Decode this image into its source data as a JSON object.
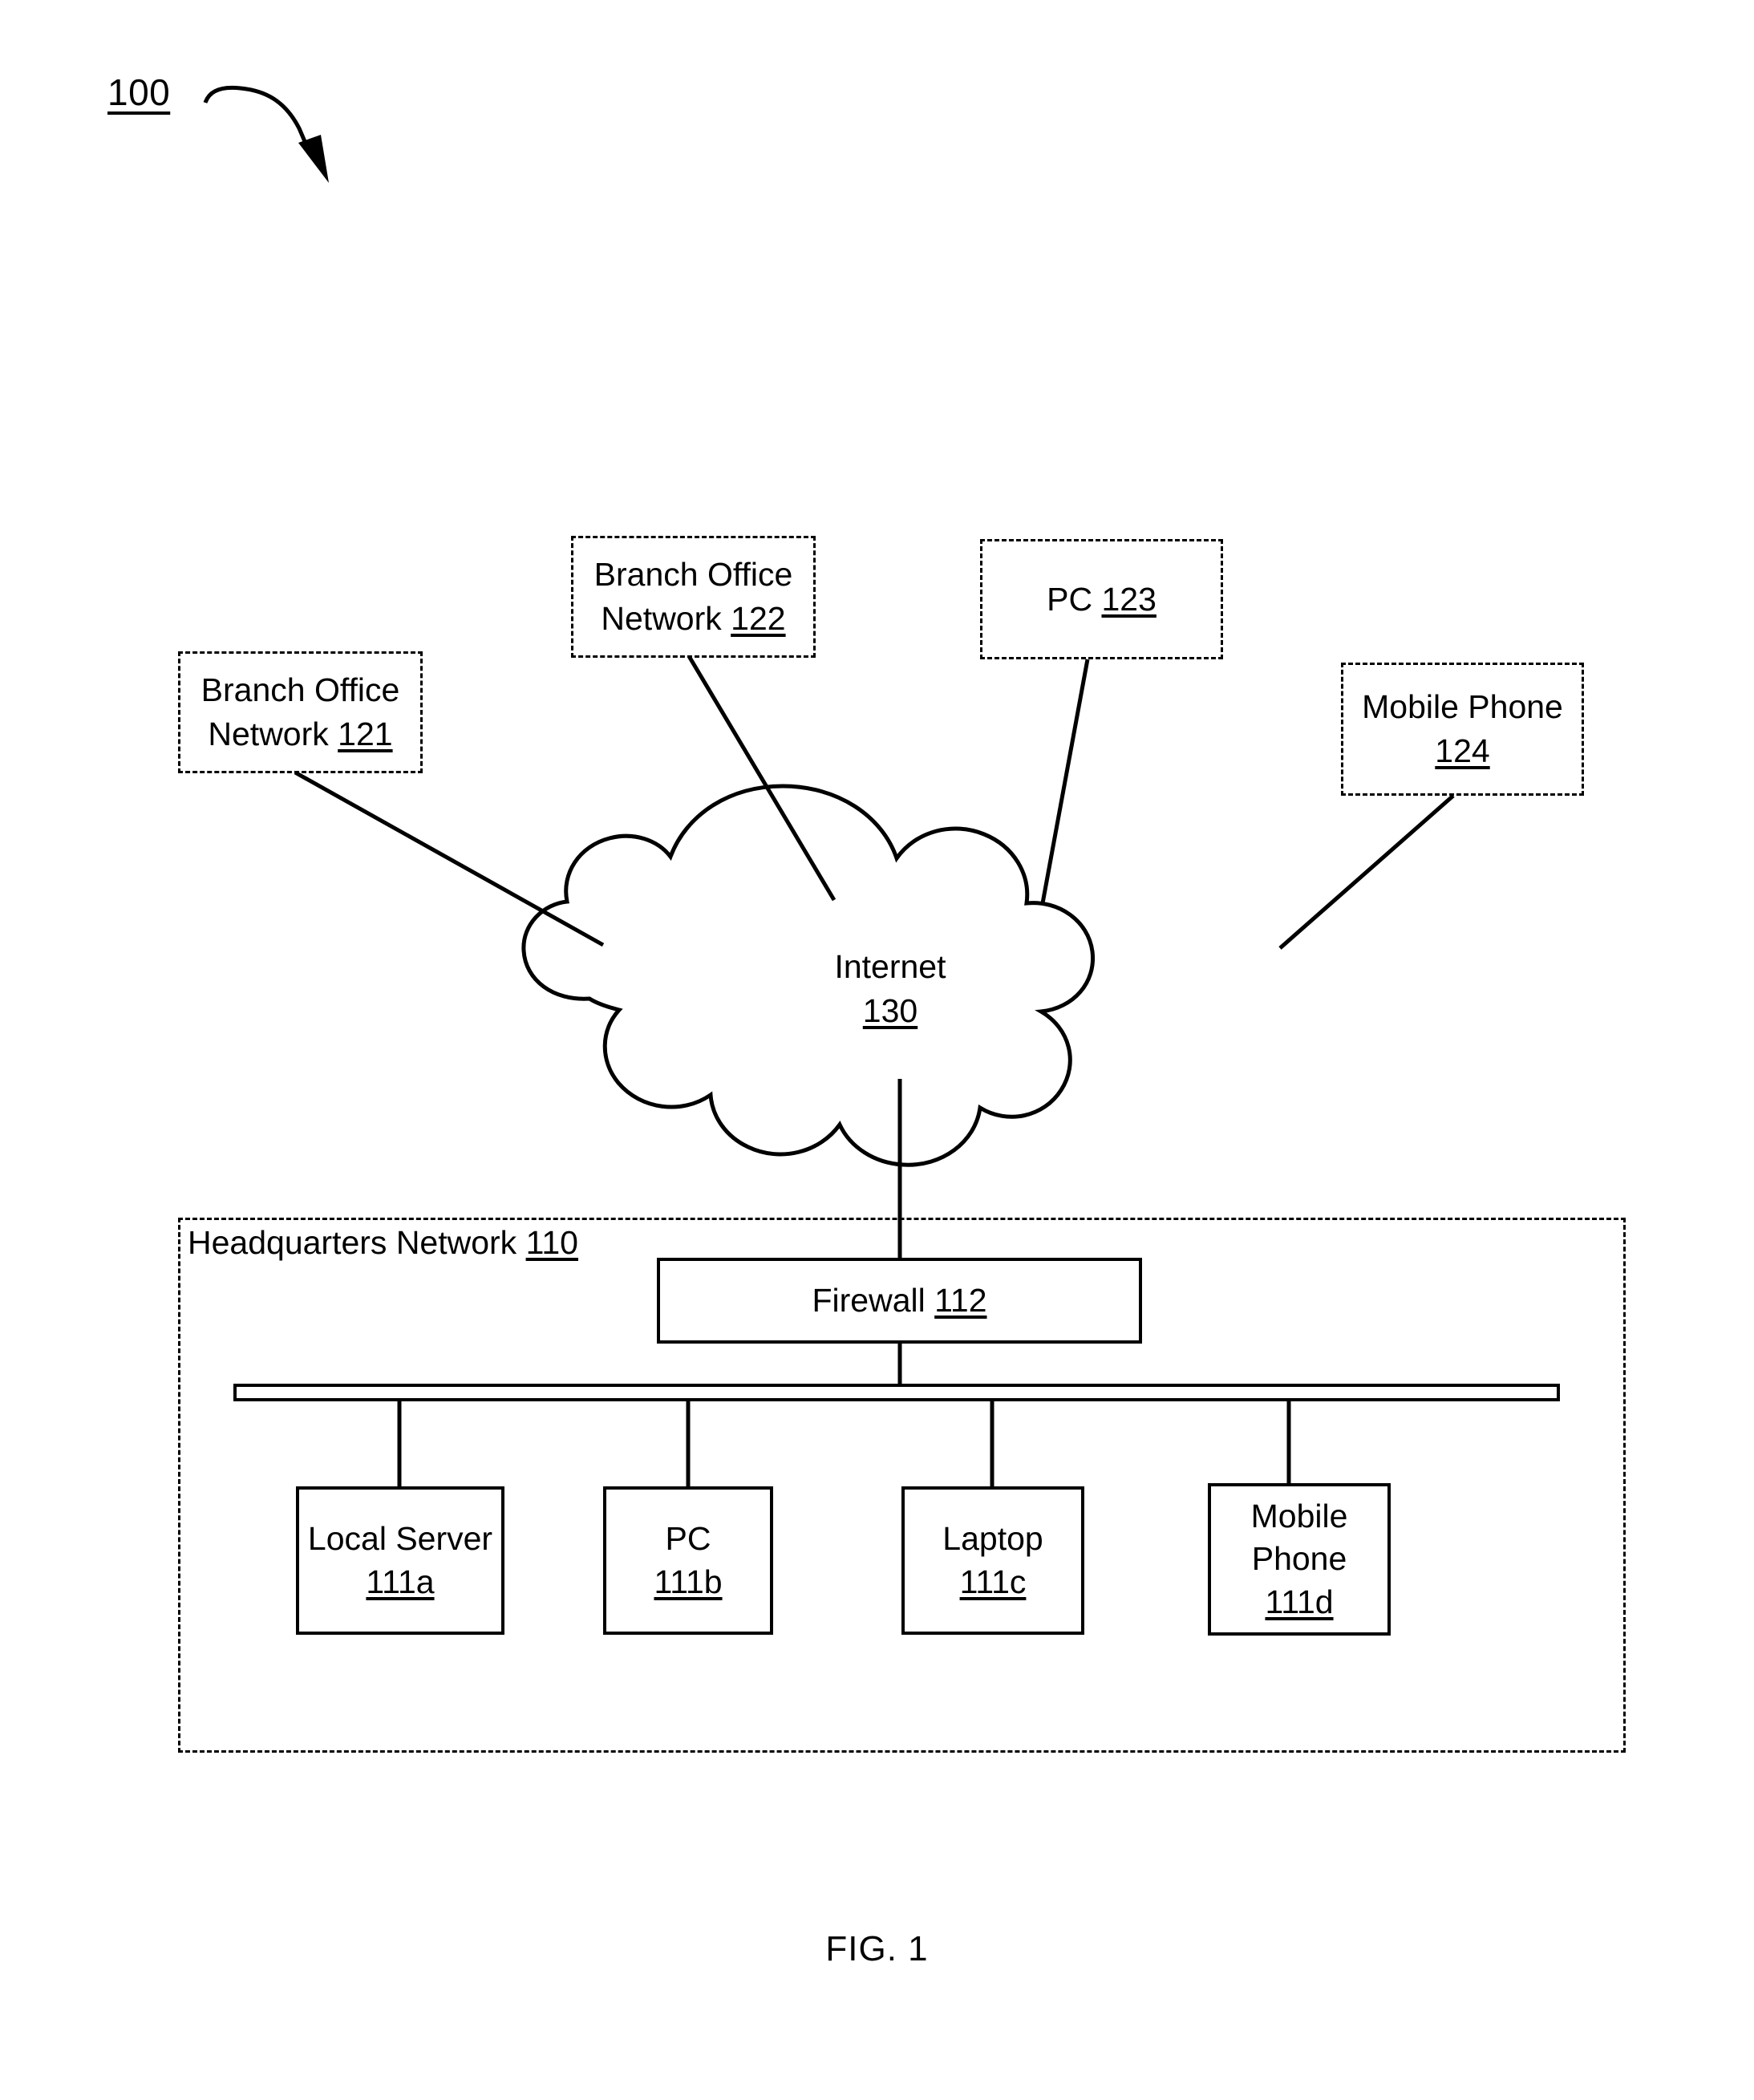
{
  "figure": {
    "reference_numeral": "100",
    "caption": "FIG. 1"
  },
  "external_nodes": [
    {
      "id": "branch-office-network-121",
      "name": "branch-office-network-121",
      "line1": "Branch Office",
      "line2": "Network",
      "ref": "121"
    },
    {
      "id": "branch-office-network-122",
      "name": "branch-office-network-122",
      "line1": "Branch Office",
      "line2": "Network",
      "ref": "122"
    },
    {
      "id": "pc-123",
      "name": "pc-123",
      "line1": "PC",
      "line2": "",
      "ref": "123"
    },
    {
      "id": "mobile-phone-124",
      "name": "mobile-phone-124",
      "line1": "Mobile Phone",
      "line2": "",
      "ref": "124"
    }
  ],
  "cloud": {
    "label": "Internet",
    "ref": "130"
  },
  "headquarters": {
    "label": "Headquarters Network",
    "ref": "110",
    "firewall": {
      "label": "Firewall",
      "ref": "112"
    },
    "devices": [
      {
        "line1": "Local Server",
        "line2": "",
        "ref": "111a"
      },
      {
        "line1": "PC",
        "line2": "",
        "ref": "111b"
      },
      {
        "line1": "Laptop",
        "line2": "",
        "ref": "111c"
      },
      {
        "line1": "Mobile",
        "line2": "Phone",
        "ref": "111d"
      }
    ]
  },
  "colors": {
    "ink": "#000000",
    "background": "#ffffff"
  }
}
